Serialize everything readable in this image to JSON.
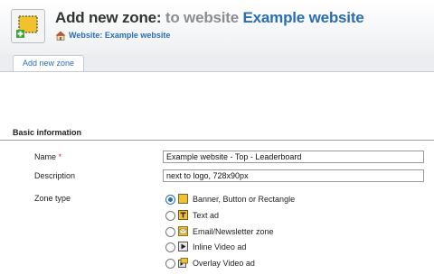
{
  "header": {
    "title": "Add new zone:",
    "title_context": "to website",
    "title_link": "Example website",
    "breadcrumb": "Website: Example website"
  },
  "tabs": [
    {
      "label": "Add new zone",
      "active": true
    }
  ],
  "form": {
    "section_title": "Basic information",
    "name": {
      "label": "Name",
      "required_mark": "*",
      "value": "Example website - Top - Leaderboard"
    },
    "description": {
      "label": "Description",
      "value": "next to logo, 728x90px"
    },
    "zone_type": {
      "label": "Zone type",
      "options": [
        {
          "label": "Banner, Button or Rectangle",
          "icon": "banner-icon",
          "selected": true
        },
        {
          "label": "Text ad",
          "icon": "text-ad-icon",
          "selected": false
        },
        {
          "label": "Email/Newsletter zone",
          "icon": "email-icon",
          "selected": false
        },
        {
          "label": "Inline Video ad",
          "icon": "video-icon",
          "selected": false
        },
        {
          "label": "Overlay Video ad",
          "icon": "overlay-video-icon",
          "selected": false
        }
      ]
    }
  },
  "colors": {
    "accent": "#2a6db3",
    "muted": "#8a8d91",
    "required": "#d03030",
    "icon_yellow": "#f2c12e"
  }
}
